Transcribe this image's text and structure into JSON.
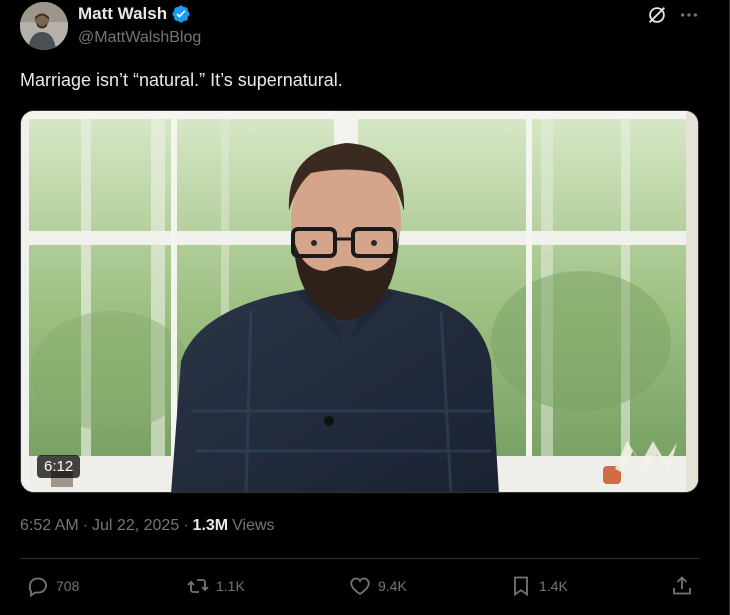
{
  "author": {
    "display_name": "Matt Walsh",
    "handle": "@MattWalshBlog",
    "verified": true,
    "verified_color": "#1d9bf0"
  },
  "tweet": {
    "text": "Marriage isn’t “natural.” It’s supernatural."
  },
  "media": {
    "type": "video",
    "duration": "6:12"
  },
  "meta": {
    "time": "6:52 AM",
    "separator": "·",
    "date": "Jul 22, 2025",
    "views_count": "1.3M",
    "views_label": "Views"
  },
  "actions": {
    "replies": "708",
    "reposts": "1.1K",
    "likes": "9.4K",
    "bookmarks": "1.4K"
  },
  "icons": {
    "grok": "grok-icon",
    "more": "more-icon",
    "reply": "reply-icon",
    "repost": "repost-icon",
    "like": "heart-icon",
    "bookmark": "bookmark-icon",
    "share": "share-icon"
  },
  "colors": {
    "background": "#000000",
    "text": "#e7e9ea",
    "secondary_text": "#71767b",
    "divider": "#2f3336"
  }
}
